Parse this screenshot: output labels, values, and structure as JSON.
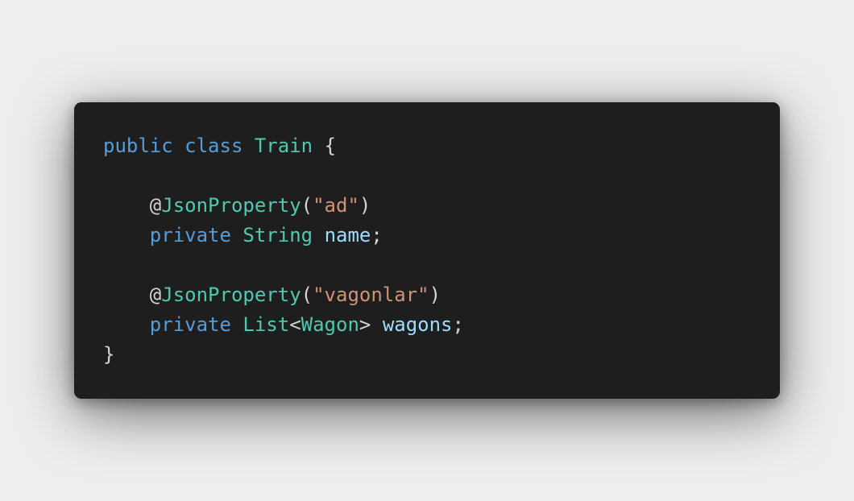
{
  "colors": {
    "background": "#eeeeee",
    "editor_background": "#1e1e1e",
    "keyword": "#569cd6",
    "type": "#4ec9b0",
    "string": "#ce9178",
    "variable": "#9cdcfe",
    "punctuation": "#d4d4d4"
  },
  "code": {
    "line1": {
      "kw_public": "public",
      "kw_class": "class",
      "class_name": "Train",
      "open_brace": "{"
    },
    "line3": {
      "at": "@",
      "annotation": "JsonProperty",
      "open_paren": "(",
      "string": "\"ad\"",
      "close_paren": ")"
    },
    "line4": {
      "kw_private": "private",
      "type": "String",
      "field": "name",
      "semicolon": ";"
    },
    "line6": {
      "at": "@",
      "annotation": "JsonProperty",
      "open_paren": "(",
      "string": "\"vagonlar\"",
      "close_paren": ")"
    },
    "line7": {
      "kw_private": "private",
      "type": "List",
      "lt": "<",
      "generic": "Wagon",
      "gt": ">",
      "field": "wagons",
      "semicolon": ";"
    },
    "line8": {
      "close_brace": "}"
    }
  }
}
